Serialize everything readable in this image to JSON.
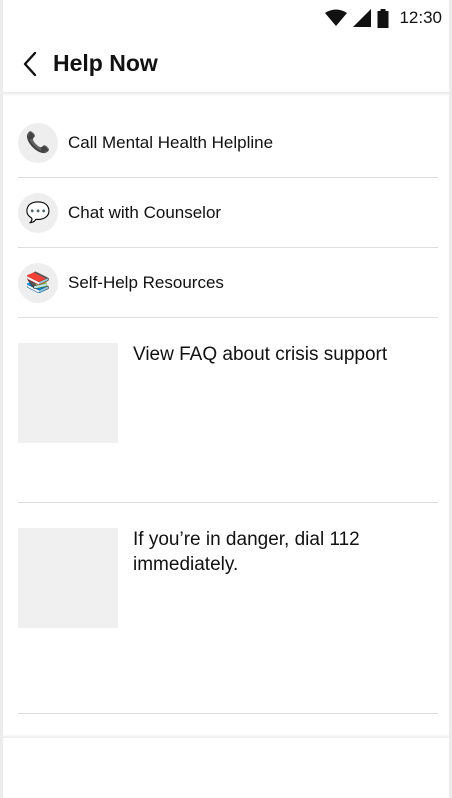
{
  "status_bar": {
    "time": "12:30",
    "icons": [
      "wifi-icon",
      "signal-icon",
      "battery-icon"
    ]
  },
  "app_bar": {
    "back_icon": "chevron-left-icon",
    "title": "Help Now"
  },
  "menu": [
    {
      "icon": "phone-icon",
      "glyph": "📞",
      "label": "Call Mental Health Helpline"
    },
    {
      "icon": "chat-bubble-icon",
      "glyph": "💬",
      "label": "Chat with Counselor"
    },
    {
      "icon": "books-icon",
      "glyph": "📚",
      "label": "Self-Help Resources"
    }
  ],
  "cards": [
    {
      "text": "View FAQ about crisis support"
    },
    {
      "text": "If you’re in danger, dial 112 immediately."
    }
  ],
  "colors": {
    "background": "#ffffff",
    "frame": "#ececec",
    "divider": "#dedede",
    "icon_circle": "#eeeeee",
    "placeholder": "#f0f0f0",
    "text": "#111111"
  }
}
